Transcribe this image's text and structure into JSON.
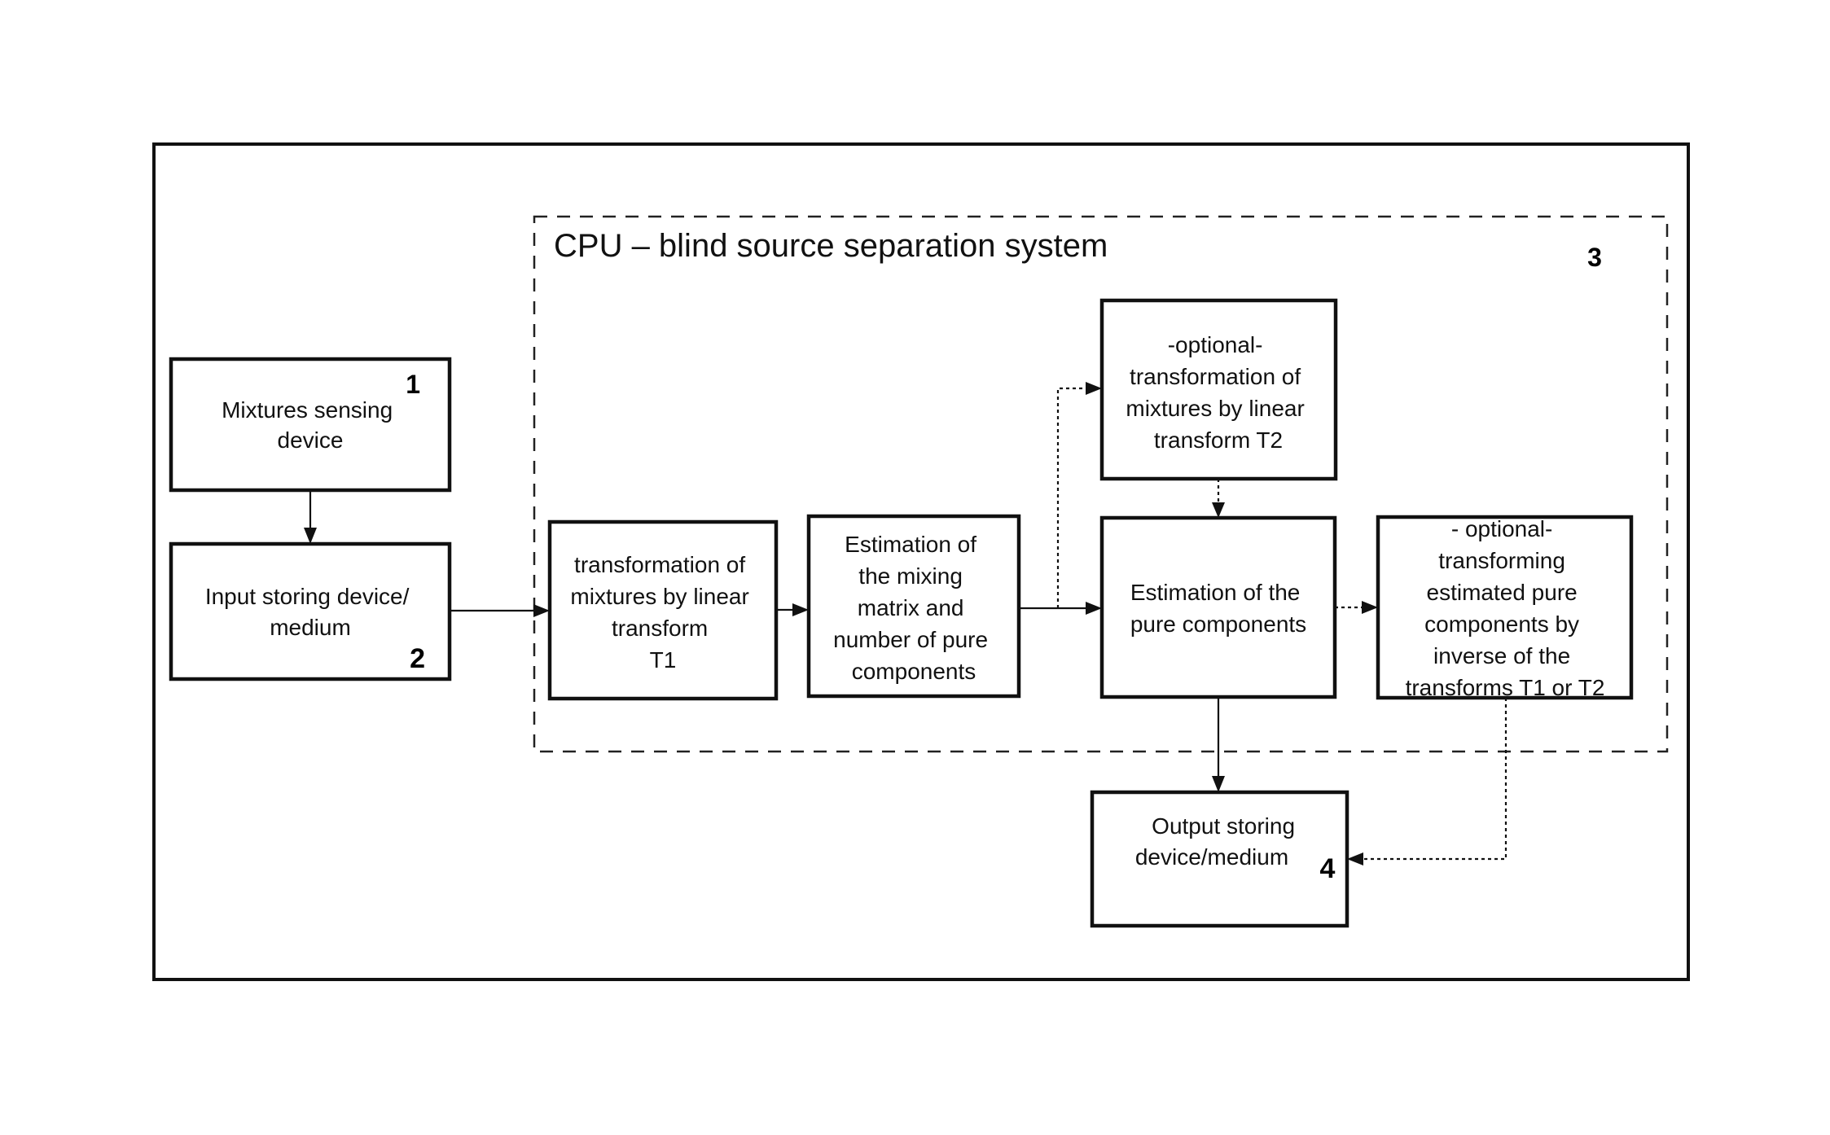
{
  "diagram": {
    "system_title": "CPU – blind source separation system",
    "system_number": "3",
    "blocks": {
      "mixtures_sensing": {
        "lines": [
          "Mixtures sensing",
          "device"
        ],
        "number": "1"
      },
      "input_storing": {
        "lines": [
          "Input storing device/",
          "medium"
        ],
        "number": "2"
      },
      "transform_t1": {
        "lines": [
          "transformation of",
          "mixtures by linear",
          "transform",
          "T1"
        ]
      },
      "estimation_mixing": {
        "lines": [
          "Estimation of",
          "the mixing",
          "matrix and",
          "number of pure",
          "components"
        ]
      },
      "optional_t2": {
        "lines": [
          "-optional-",
          "transformation of",
          "mixtures by linear",
          "transform T2"
        ]
      },
      "estimation_pure": {
        "lines": [
          "Estimation of the",
          "pure components"
        ]
      },
      "optional_inverse": {
        "lines": [
          "- optional-",
          "transforming",
          "estimated pure",
          "components by",
          "inverse of the",
          "transforms T1 or T2"
        ]
      },
      "output_storing": {
        "lines": [
          "Output storing",
          "device/medium"
        ],
        "number": "4"
      }
    },
    "connections": [
      {
        "from": "mixtures_sensing",
        "to": "input_storing",
        "style": "solid"
      },
      {
        "from": "input_storing",
        "to": "transform_t1",
        "style": "solid"
      },
      {
        "from": "transform_t1",
        "to": "estimation_mixing",
        "style": "solid"
      },
      {
        "from": "estimation_mixing",
        "to": "estimation_pure",
        "style": "solid"
      },
      {
        "from": "estimation_mixing",
        "to": "optional_t2",
        "style": "dotted"
      },
      {
        "from": "optional_t2",
        "to": "estimation_pure",
        "style": "dotted"
      },
      {
        "from": "estimation_pure",
        "to": "optional_inverse",
        "style": "dotted"
      },
      {
        "from": "estimation_pure",
        "to": "output_storing",
        "style": "solid"
      },
      {
        "from": "optional_inverse",
        "to": "output_storing",
        "style": "dotted"
      }
    ]
  }
}
